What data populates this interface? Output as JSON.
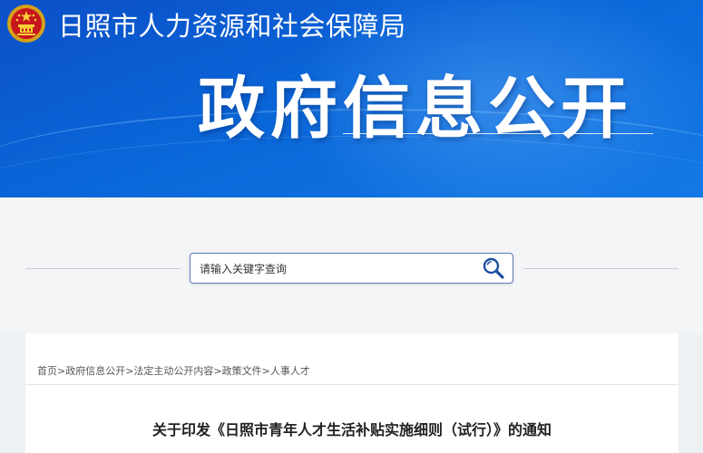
{
  "header": {
    "site_name": "日照市人力资源和社会保障局",
    "section_title": "政府信息公开",
    "emblem_icon": "national-emblem-icon"
  },
  "search": {
    "placeholder": "请输入关键字查询",
    "button_icon": "search-icon"
  },
  "breadcrumb": {
    "items": [
      "首页",
      "政府信息公开",
      "法定主动公开内容",
      "政策文件",
      "人事人才"
    ],
    "separator": ">"
  },
  "article": {
    "title": "关于印发《日照市青年人才生活补贴实施细则（试行）》的通知"
  },
  "colors": {
    "banner": "#0a66d8",
    "search_border": "#5b7fb8"
  }
}
